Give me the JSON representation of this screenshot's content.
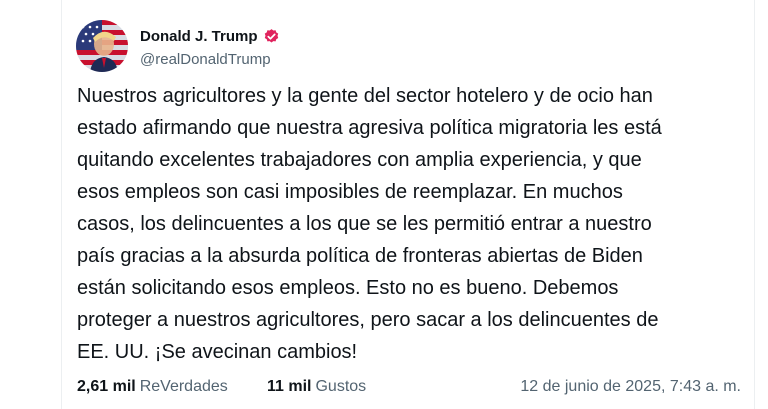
{
  "author": {
    "name": "Donald J. Trump",
    "handle": "@realDonaldTrump",
    "verified_color": "#e0245e"
  },
  "post": {
    "lines": [
      "Nuestros agricultores y la gente del sector hotelero y de ocio han",
      "estado afirmando que nuestra agresiva política migratoria les está",
      "quitando excelentes trabajadores con amplia experiencia, y que",
      "esos empleos son casi imposibles de reemplazar. En muchos",
      "casos, los delincuentes a los que se les permitió entrar a nuestro",
      "país gracias a la absurda política de fronteras abiertas de Biden",
      "están solicitando esos empleos. Esto no es bueno. Debemos",
      "proteger a nuestros agricultores, pero sacar a los delincuentes de",
      "EE. UU. ¡Se avecinan cambios!"
    ]
  },
  "stats": {
    "reposts_count": "2,61 mil",
    "reposts_label": "ReVerdades",
    "likes_count": "11 mil",
    "likes_label": "Gustos"
  },
  "timestamp": "12 de junio de 2025, 7:43 a. m."
}
